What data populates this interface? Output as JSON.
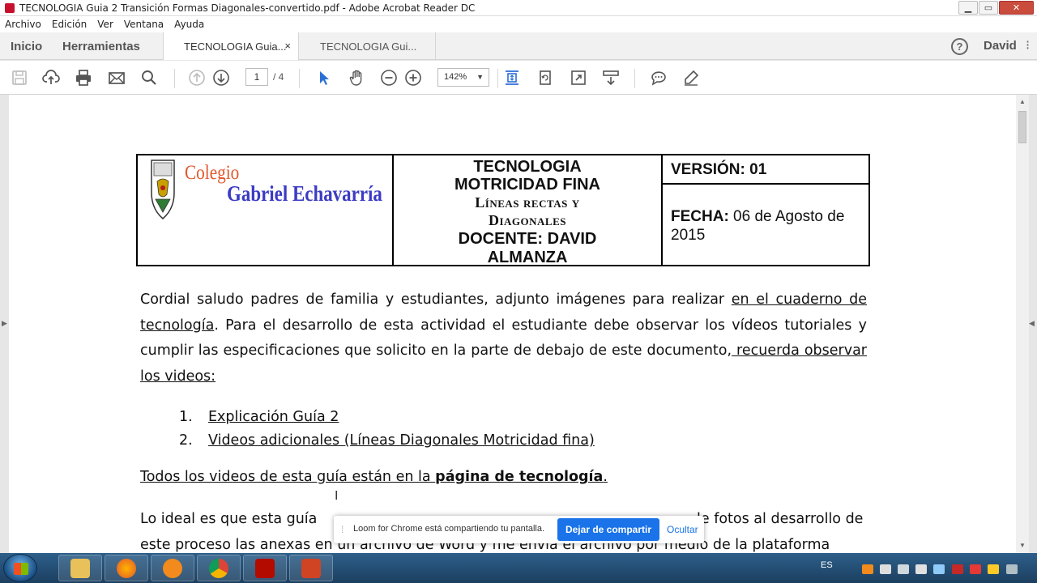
{
  "window": {
    "title": "TECNOLOGIA Guia 2 Transición Formas Diagonales-convertido.pdf - Adobe Acrobat Reader DC",
    "controls": {
      "minimize": "▁",
      "maximize": "▭",
      "close": "✕"
    }
  },
  "menu": [
    "Archivo",
    "Edición",
    "Ver",
    "Ventana",
    "Ayuda"
  ],
  "nav": {
    "home": "Inicio",
    "tools": "Herramientas",
    "tabs": [
      {
        "label": "TECNOLOGIA Guia...",
        "close": "×",
        "active": true
      },
      {
        "label": "TECNOLOGIA  Gui...",
        "active": false
      }
    ],
    "help": "?",
    "user": "David",
    "more": "⁝"
  },
  "toolbar": {
    "page_current": "1",
    "page_total": "/  4",
    "zoom": "142%",
    "zoom_caret": "▼"
  },
  "document": {
    "header": {
      "school_line1": "Colegio",
      "school_line2": "Gabriel Echavarría",
      "subject_lines": [
        "TECNOLOGIA",
        "MOTRICIDAD FINA"
      ],
      "topic_lines": [
        "Líneas rectas y",
        "Diagonales"
      ],
      "teacher_lines": [
        "DOCENTE: DAVID",
        "ALMANZA"
      ],
      "version": "VERSIÓN: 01",
      "fecha_label": "FECHA:",
      "fecha_value": " 06 de Agosto de 2015"
    },
    "intro": {
      "part1": "Cordial saludo padres de familia y estudiantes, adjunto imágenes para realizar ",
      "part2": "en el cuaderno de tecnología",
      "part3": ".   Para el desarrollo de esta actividad el estudiante debe observar los vídeos tutoriales y cumplir las especificaciones que solicito en la parte de debajo de este documento,",
      "part4": " recuerda observar los videos:"
    },
    "list": [
      {
        "num": "1.",
        "text": "Explicación Guía 2"
      },
      {
        "num": "2.",
        "text": " Videos adicionales (Líneas Diagonales Motricidad fina)"
      }
    ],
    "videos_line": {
      "prefix": "Todos los videos de esta guía están en la ",
      "bold": "página de tecnología",
      "suffix": "."
    },
    "para3": {
      "left_line1": "Lo ideal es que esta guía",
      "right_line1": "le fotos al desarrollo de",
      "line2": "este proceso las anexas en un archivo de Word y me envía el archivo por medio de la plataforma"
    }
  },
  "share_bar": {
    "grip": "⁞",
    "message": "Loom for Chrome está compartiendo tu pantalla.",
    "stop_label": "Dejar de compartir",
    "hide_label": "Ocultar"
  },
  "taskbar": {
    "language": "ES"
  },
  "colors": {
    "school_orange": "#e2572c",
    "school_blue": "#3b3bc4",
    "share_blue": "#1a73e8"
  }
}
